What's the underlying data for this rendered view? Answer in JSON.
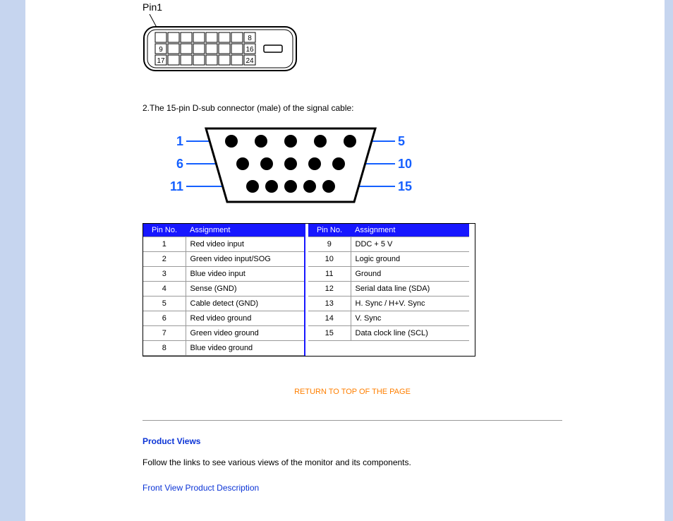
{
  "dvi": {
    "pin1_label": "Pin1",
    "visible_numbers": [
      "8",
      "9",
      "16",
      "17",
      "24"
    ]
  },
  "caption2": "2.The 15-pin D-sub connector (male) of the signal cable:",
  "vga_labels": {
    "l1": "1",
    "l6": "6",
    "l11": "11",
    "r5": "5",
    "r10": "10",
    "r15": "15"
  },
  "table_left": {
    "head_pin": "Pin No.",
    "head_assign": "Assignment",
    "rows": [
      {
        "n": "1",
        "a": "Red video input"
      },
      {
        "n": "2",
        "a": "Green video input/SOG"
      },
      {
        "n": "3",
        "a": "Blue video input"
      },
      {
        "n": "4",
        "a": "Sense (GND)"
      },
      {
        "n": "5",
        "a": "Cable detect (GND)"
      },
      {
        "n": "6",
        "a": "Red video ground"
      },
      {
        "n": "7",
        "a": "Green video ground"
      },
      {
        "n": "8",
        "a": "Blue video ground"
      }
    ]
  },
  "table_right": {
    "head_pin": "Pin No.",
    "head_assign": "Assignment",
    "rows": [
      {
        "n": "9",
        "a": "DDC + 5 V"
      },
      {
        "n": "10",
        "a": "Logic ground"
      },
      {
        "n": "11",
        "a": "Ground"
      },
      {
        "n": "12",
        "a": "Serial data line (SDA)"
      },
      {
        "n": "13",
        "a": "H. Sync / H+V. Sync"
      },
      {
        "n": "14",
        "a": "V. Sync"
      },
      {
        "n": "15",
        "a": "Data clock line (SCL)"
      }
    ]
  },
  "return_link": "RETURN TO TOP OF THE PAGE",
  "product_views": {
    "heading": "Product Views",
    "desc": "Follow the links to see various views of the monitor and its components.",
    "front_link": "Front View Product Description"
  }
}
